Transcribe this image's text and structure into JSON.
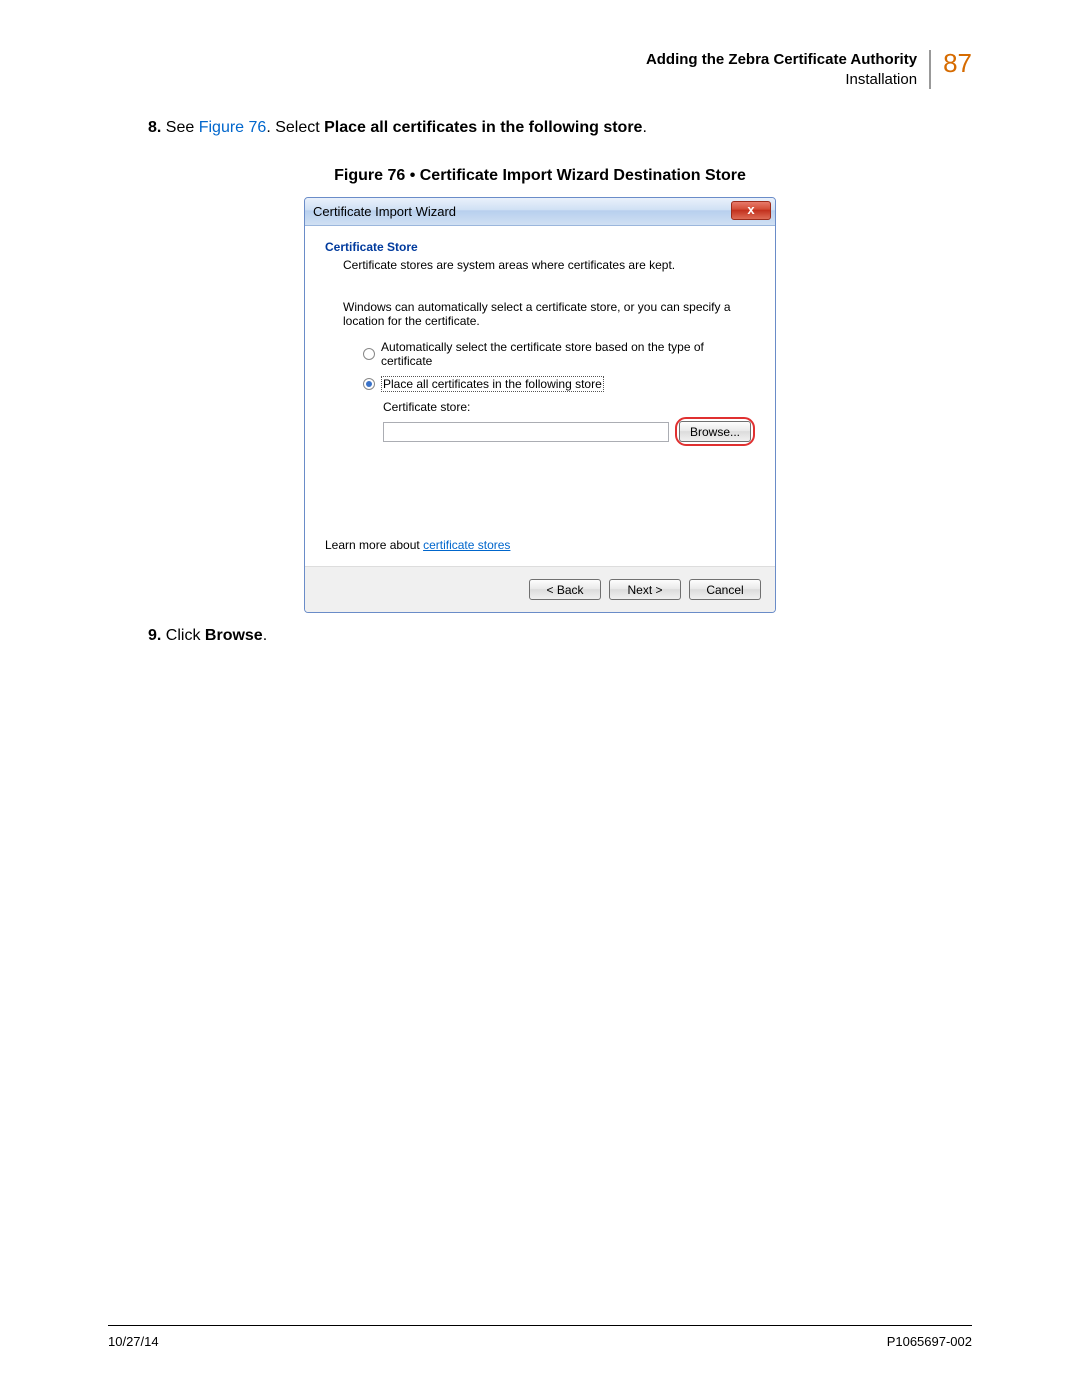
{
  "header": {
    "line1": "Adding the Zebra Certificate Authority",
    "line2": "Installation",
    "page_number": "87"
  },
  "step8": {
    "num": "8.",
    "lead": "See ",
    "figref": "Figure 76",
    "mid": ". Select ",
    "bold": "Place all certificates in the following store",
    "end": "."
  },
  "figure_caption": "Figure 76 • Certificate Import Wizard Destination Store",
  "dialog": {
    "title": "Certificate Import Wizard",
    "close_glyph": "x",
    "section_title": "Certificate Store",
    "section_desc": "Certificate stores are system areas where certificates are kept.",
    "instruction": "Windows can automatically select a certificate store, or you can specify a location for the certificate.",
    "radio_auto": "Automatically select the certificate store based on the type of certificate",
    "radio_place": "Place all certificates in the following store",
    "store_label": "Certificate store:",
    "browse_label": "Browse...",
    "learn_prefix": "Learn more about ",
    "learn_link": "certificate stores",
    "back_label": "< Back",
    "next_label": "Next >",
    "cancel_label": "Cancel"
  },
  "step9": {
    "num": "9.",
    "lead": "Click ",
    "bold": "Browse",
    "end": "."
  },
  "footer": {
    "date": "10/27/14",
    "docnum": "P1065697-002"
  }
}
